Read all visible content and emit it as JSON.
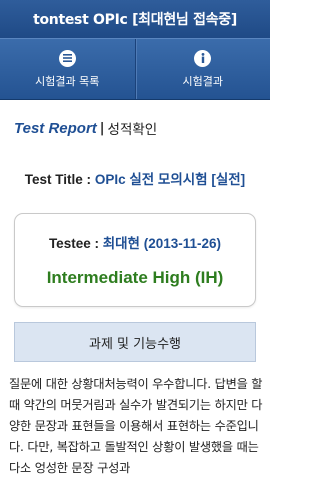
{
  "app": {
    "title": "tontest OPIc [최대현님 접속중]"
  },
  "tabs": [
    {
      "label": "시험결과 목록",
      "icon": "list-icon"
    },
    {
      "label": "시험결과",
      "icon": "info-icon"
    }
  ],
  "report": {
    "heading_en": "Test Report",
    "separator": "|",
    "heading_ko": "성적확인",
    "test_title_label": "Test Title : ",
    "test_title_value": "OPIc 실전 모의시험 [실전]",
    "testee_label": "Testee : ",
    "testee_value": "최대현 (2013-11-26)",
    "level": "Intermediate High (IH)",
    "section_title": "과제 및 기능수행",
    "description": "질문에 대한 상황대처능력이 우수합니다. 답변을 할 때 약간의 머뭇거림과 실수가 발견되기는 하지만 다양한 문장과 표현들을 이용해서 표현하는 수준입니다. 다만, 복잡하고 돌발적인 상황이 발생했을 때는 다소 엉성한 문장 구성과"
  },
  "colors": {
    "header_blue": "#2f5d9b",
    "accent_blue": "#1f4f94",
    "level_green": "#2e7d1f",
    "section_bg": "#dbe5f2"
  }
}
